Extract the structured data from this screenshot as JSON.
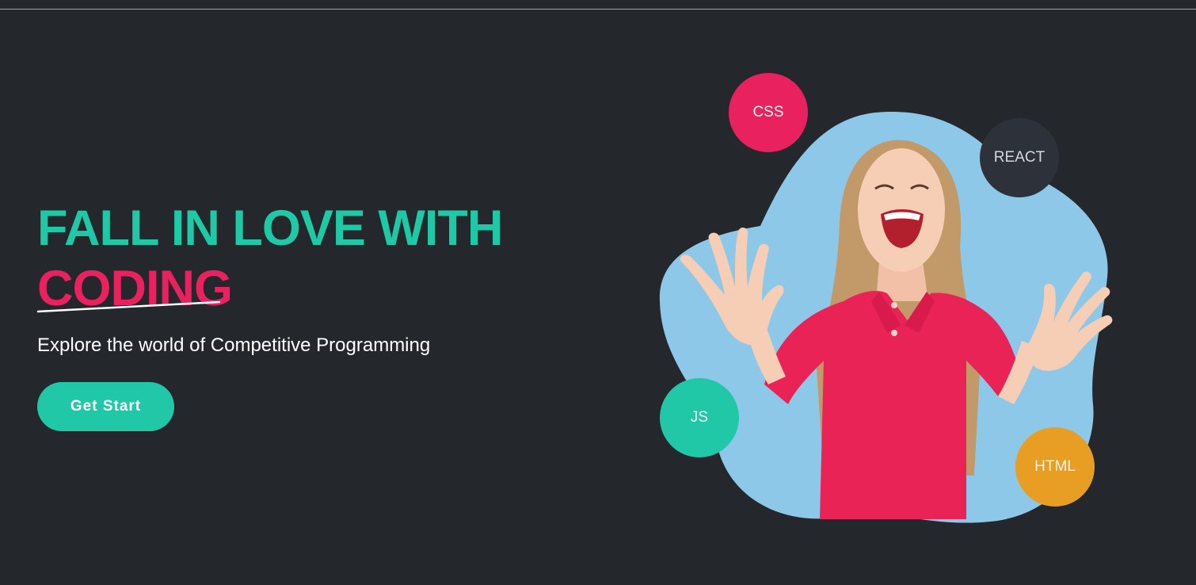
{
  "hero": {
    "headline_line1": "FALL IN LOVE WITH",
    "headline_line2": "CODING",
    "subtitle": "Explore the world of Competitive Programming",
    "cta_label": "Get Start"
  },
  "badges": {
    "css": "CSS",
    "react": "REACT",
    "js": "JS",
    "html": "HTML"
  },
  "colors": {
    "background": "#24282d",
    "accent_teal": "#21c8a8",
    "accent_pink": "#e9215f",
    "blob_blue": "#8ec8e8",
    "badge_dark": "#2d323a",
    "badge_orange": "#e79e22"
  }
}
